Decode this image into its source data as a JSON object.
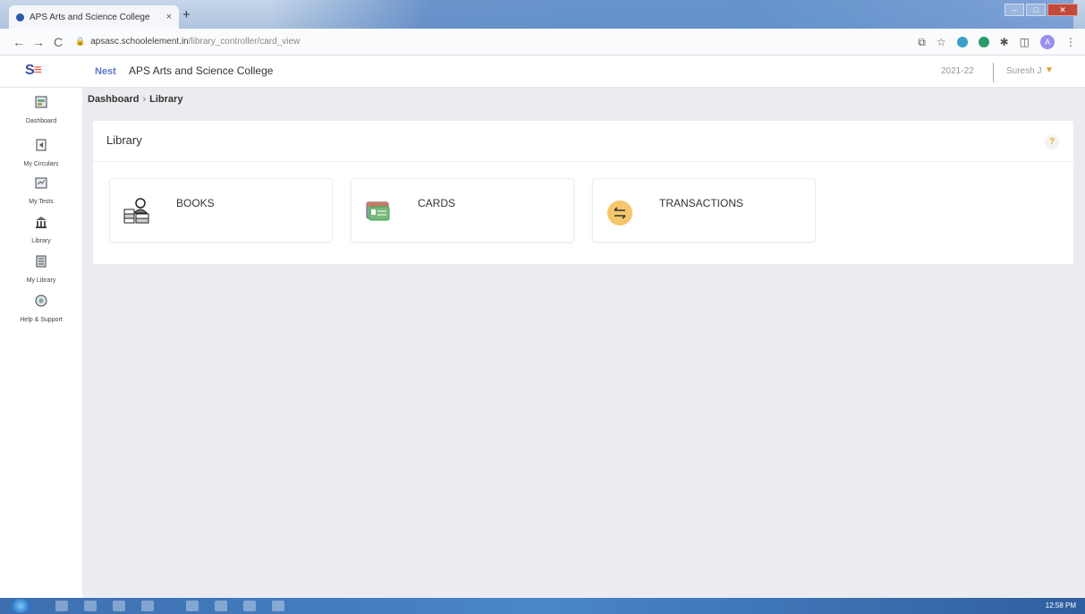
{
  "browser": {
    "tab_title": "APS Arts and Science College",
    "tab_close": "×",
    "new_tab": "+",
    "url_domain": "apsasc.schoolelement.in",
    "url_path": "/library_controller/card_view",
    "win_min": "–",
    "win_max": "□",
    "win_close": "✕"
  },
  "app": {
    "logo_s": "S",
    "logo_e": "≡",
    "brand_small": "Nest",
    "college_name": "APS Arts and Science College",
    "academic_year": "2021-22",
    "user_name": "Suresh J"
  },
  "sidebar": {
    "items": [
      {
        "label": "Dashboard",
        "icon": "dashboard-icon"
      },
      {
        "label": "My Circulars",
        "icon": "circulars-icon"
      },
      {
        "label": "My Tests",
        "icon": "tests-icon"
      },
      {
        "label": "Library",
        "icon": "library-icon"
      },
      {
        "label": "My Library",
        "icon": "my-library-icon"
      },
      {
        "label": "Help & Support",
        "icon": "help-support-icon"
      }
    ]
  },
  "breadcrumb": {
    "root": "Dashboard",
    "separator": "›",
    "current": "Library"
  },
  "panel": {
    "title": "Library",
    "help": "?"
  },
  "cards": [
    {
      "label": "BOOKS",
      "icon": "books-reader-icon"
    },
    {
      "label": "CARDS",
      "icon": "library-card-icon"
    },
    {
      "label": "TRANSACTIONS",
      "icon": "transactions-icon"
    }
  ],
  "taskbar": {
    "clock": "12:58 PM"
  },
  "colors": {
    "accent_orange": "#e8a42a",
    "page_bg": "#ececf0",
    "logo_blue": "#3a4a9a",
    "logo_red": "#e04a3a"
  }
}
